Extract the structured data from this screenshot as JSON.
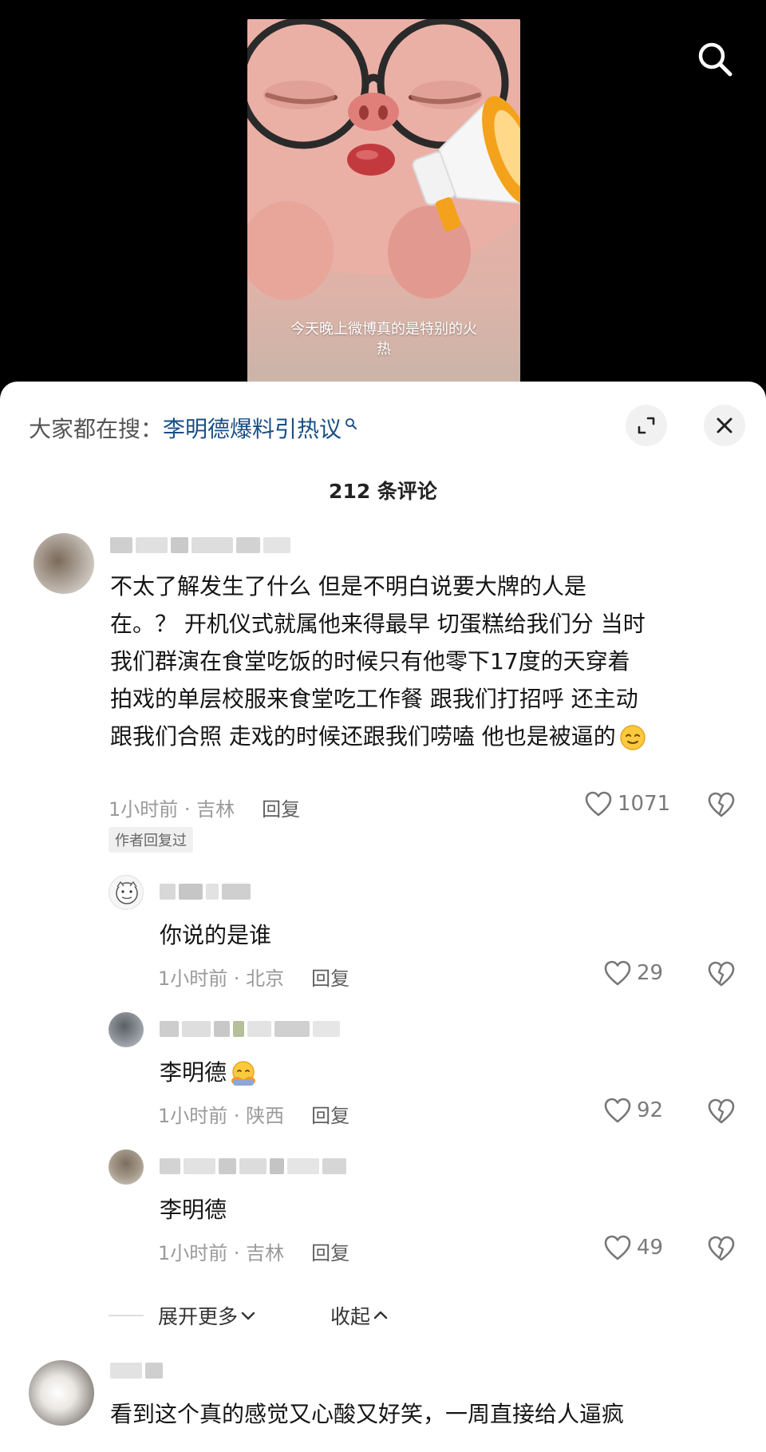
{
  "video": {
    "caption": "今天晚上微博真的是特别的火热",
    "caption_line1": "今天晚上微博真的是特别的火",
    "caption_line2": "热"
  },
  "search": {
    "prefix": "大家都在搜：",
    "keyword": "李明德爆料引热议"
  },
  "comments": {
    "count_label": "212 条评论",
    "main": {
      "lines": [
        "不太了解发生了什么 但是不明白说要大牌的人是",
        "在。？ 开机仪式就属他来得最早 切蛋糕给我们分 当时",
        "我们群演在食堂吃饭的时候只有他零下17度的天穿着",
        "拍戏的单层校服来食堂吃工作餐 跟我们打招呼 还主动",
        "跟我们合照 走戏的时候还跟我们唠嗑 他也是被逼的"
      ],
      "time_location": "1小时前 · 吉林",
      "reply_label": "回复",
      "likes": "1071",
      "badge": "作者回复过"
    },
    "replies": [
      {
        "text": "你说的是谁",
        "time_location": "1小时前 · 北京",
        "reply_label": "回复",
        "likes": "29"
      },
      {
        "text": "李明德",
        "time_location": "1小时前 · 陕西",
        "reply_label": "回复",
        "likes": "92"
      },
      {
        "text": "李明德",
        "time_location": "1小时前 · 吉林",
        "reply_label": "回复",
        "likes": "49"
      }
    ],
    "expand_more": "展开更多",
    "collapse": "收起",
    "next": {
      "text": "看到这个真的感觉又心酸又好笑，一周直接给人逼疯"
    }
  },
  "colors": {
    "keyword": "#1a4f86",
    "meta": "#9a9a9a",
    "background_top": "#000000",
    "sheet": "#ffffff"
  },
  "icons": [
    "search-icon",
    "expand-icon",
    "close-icon",
    "heart-icon",
    "broken-heart-icon",
    "chevron-down-icon",
    "chevron-up-icon"
  ]
}
